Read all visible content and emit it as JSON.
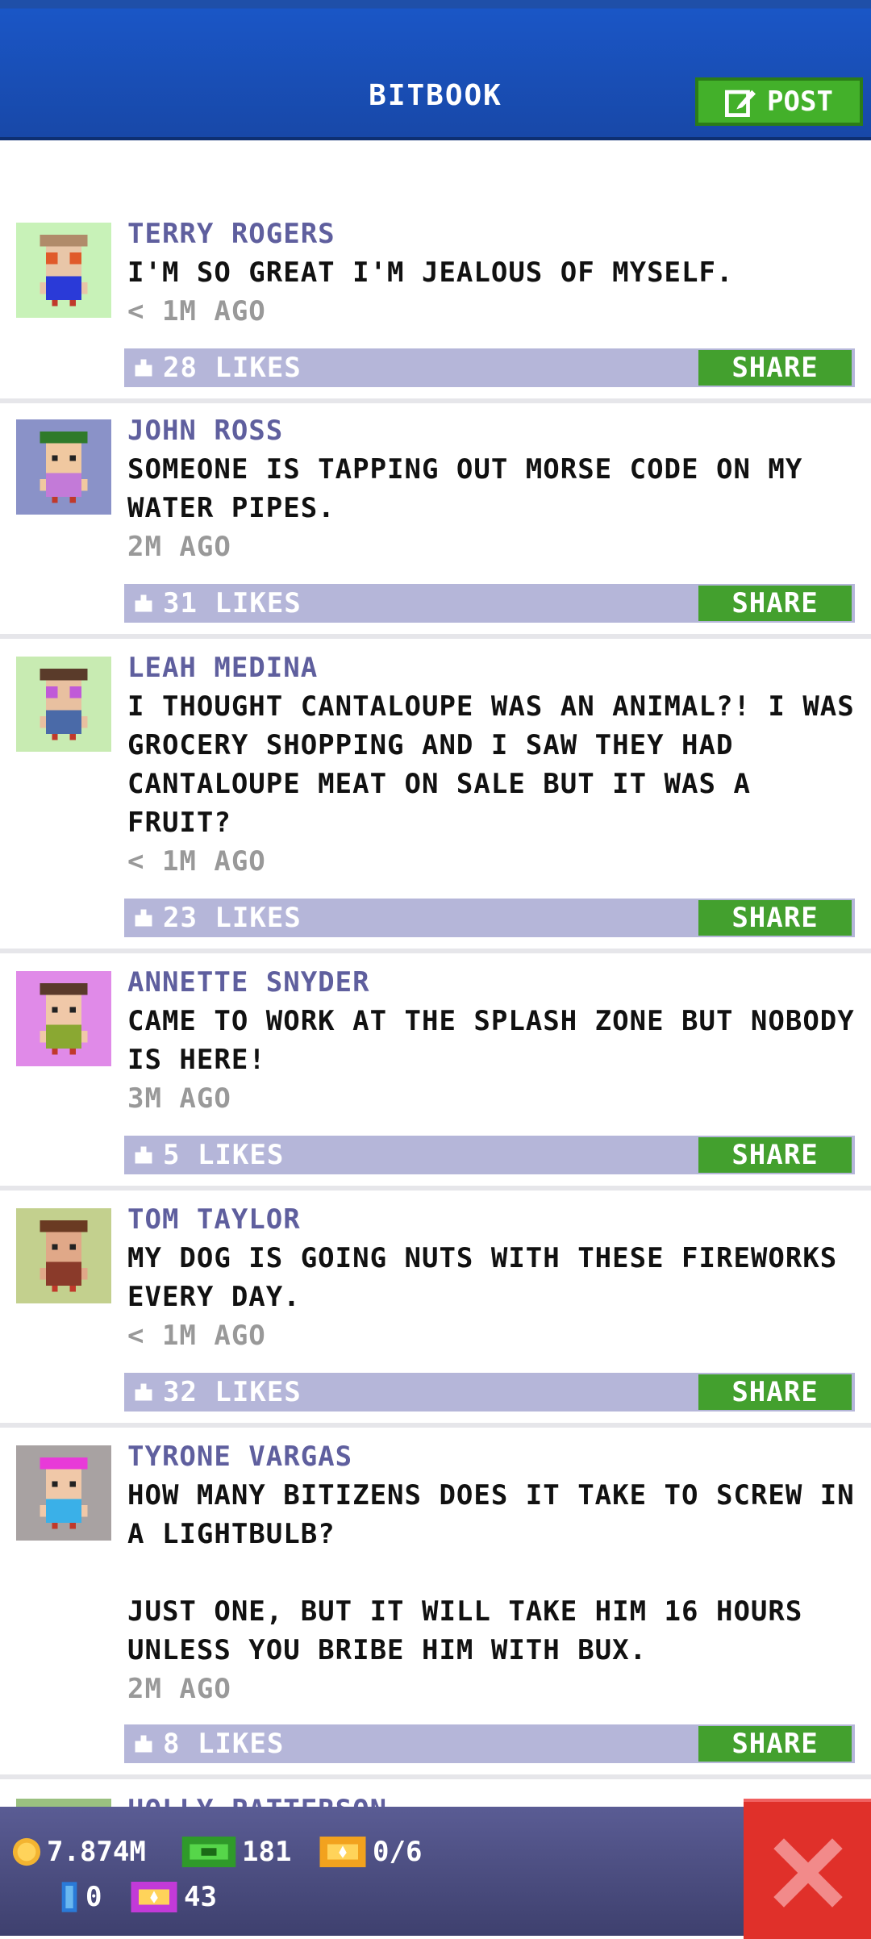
{
  "header": {
    "title": "BITBOOK",
    "post_label": "POST"
  },
  "posts": [
    {
      "author": "TERRY ROGERS",
      "text": "I'M SO GREAT I'M JEALOUS OF MYSELF.",
      "time": "< 1M AGO",
      "likes": "28 LIKES",
      "share": "SHARE",
      "avatar_bg": "#c8f2b8",
      "hair": "#b08b6a",
      "shirt": "#2a3ad8",
      "skin": "#e8c6a8",
      "glasses": "#e05a2a"
    },
    {
      "author": "JOHN ROSS",
      "text": "SOMEONE IS TAPPING OUT MORSE CODE ON MY WATER PIPES.",
      "time": "2M AGO",
      "likes": "31 LIKES",
      "share": "SHARE",
      "avatar_bg": "#8a92c8",
      "hair": "#2f7a2a",
      "shirt": "#c37ad8",
      "skin": "#f0c8a0",
      "glasses": ""
    },
    {
      "author": "LEAH MEDINA",
      "text": "I THOUGHT CANTALOUPE WAS AN ANIMAL?! I WAS GROCERY SHOPPING AND I SAW THEY HAD CANTALOUPE MEAT ON SALE BUT IT WAS A FRUIT?",
      "time": "< 1M AGO",
      "likes": "23 LIKES",
      "share": "SHARE",
      "avatar_bg": "#c8ebb2",
      "hair": "#5a3b2a",
      "shirt": "#4a6aa8",
      "skin": "#e8c0a0",
      "glasses": "#c05ad8"
    },
    {
      "author": "ANNETTE SNYDER",
      "text": "CAME TO WORK AT THE SPLASH ZONE BUT NOBODY IS HERE!",
      "time": "3M AGO",
      "likes": "5 LIKES",
      "share": "SHARE",
      "avatar_bg": "#e08ae8",
      "hair": "#5a3a2a",
      "shirt": "#8aa832",
      "skin": "#f0c8a8",
      "glasses": ""
    },
    {
      "author": "TOM TAYLOR",
      "text": "MY DOG IS GOING NUTS WITH THESE FIREWORKS EVERY DAY.",
      "time": "< 1M AGO",
      "likes": "32 LIKES",
      "share": "SHARE",
      "avatar_bg": "#c3d08e",
      "hair": "#6a3a22",
      "shirt": "#8a3a2a",
      "skin": "#e0a888",
      "glasses": ""
    },
    {
      "author": "TYRONE VARGAS",
      "text": "HOW MANY BITIZENS DOES IT TAKE TO SCREW IN A LIGHTBULB?\n\nJUST ONE, BUT IT WILL TAKE HIM 16 HOURS UNLESS YOU BRIBE HIM WITH BUX.",
      "time": "2M AGO",
      "likes": "8 LIKES",
      "share": "SHARE",
      "avatar_bg": "#a8a2a2",
      "hair": "#e83ad8",
      "shirt": "#3ab0e8",
      "skin": "#f0c8a8",
      "glasses": ""
    },
    {
      "author": "HOLLY PATTERSON",
      "text": "",
      "time": "",
      "likes": "",
      "share": "",
      "avatar_bg": "#9ac080",
      "hair": "#6a3a22",
      "shirt": "#4a6aa8",
      "skin": "#e8c0a0",
      "glasses": ""
    }
  ],
  "footer": {
    "coins": "7.874M",
    "bux": "181",
    "tickets": "0/6",
    "items": "0",
    "vip": "43"
  }
}
